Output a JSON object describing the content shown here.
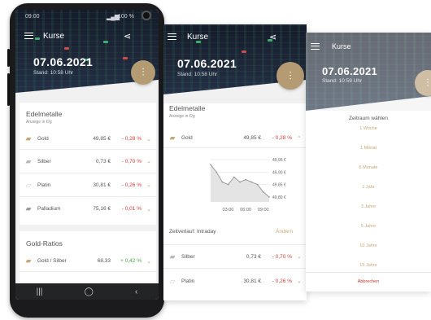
{
  "app": {
    "title": "Kurse"
  },
  "status": {
    "time": "09:00",
    "battery": "100 %"
  },
  "header": {
    "date": "07.06.2021",
    "stand_1": "Stand: 10:58 Uhr",
    "stand_2": "Stand: 10:58 Uhr",
    "stand_3": "Stand: 10:59 Uhr"
  },
  "colors": {
    "accent_gold": "#b59b73",
    "negative": "#d33a3a",
    "positive": "#4aa54a",
    "chevron": "#8ab34a"
  },
  "edelmetalle": {
    "title": "Edelmetalle",
    "subtitle": "Anzeige in €/g",
    "rows": [
      {
        "name": "Gold",
        "price": "49,85 €",
        "change": "- 0,28 %",
        "icon": "gold-bars-icon"
      },
      {
        "name": "Silber",
        "price": "0,73 €",
        "change": "- 0,70 %",
        "icon": "silver-bars-icon"
      },
      {
        "name": "Platin",
        "price": "30,81 €",
        "change": "- 0,26 %",
        "icon": "platinum-bars-icon"
      },
      {
        "name": "Palladium",
        "price": "75,16 €",
        "change": "- 0,01 %",
        "icon": "palladium-bars-icon"
      }
    ]
  },
  "gold_ratios": {
    "title": "Gold-Ratios",
    "rows": [
      {
        "name": "Gold / Silber",
        "value": "68,33",
        "change": "+ 0,42 %"
      }
    ]
  },
  "detail": {
    "gold_row": {
      "name": "Gold",
      "price": "49,85 €",
      "change": "- 0,28 %"
    },
    "y_ticks": [
      "49,95 €",
      "49,90 €",
      "49,85 €",
      "49,80 €"
    ],
    "x_ticks": [
      "03:00",
      "06:00",
      "09:00"
    ],
    "zeitverlauf": "Zeitverlauf: Intraday",
    "aendern": "Ändern",
    "rows": [
      {
        "name": "Silber",
        "price": "0,73 €",
        "change": "- 0,70 %"
      },
      {
        "name": "Platin",
        "price": "30,81 €",
        "change": "- 0,26 %"
      }
    ]
  },
  "chart_data": {
    "type": "area",
    "x": [
      "00:00",
      "01:00",
      "02:00",
      "03:00",
      "04:00",
      "05:00",
      "06:00",
      "07:00",
      "08:00",
      "09:00",
      "10:00"
    ],
    "values": [
      49.93,
      49.9,
      49.86,
      49.85,
      49.88,
      49.86,
      49.87,
      49.86,
      49.85,
      49.82,
      49.8
    ],
    "ylim": [
      49.78,
      49.97
    ],
    "title": "",
    "xlabel": "",
    "ylabel": ""
  },
  "zeitraum": {
    "title": "Zeitraum wählen",
    "options": [
      "1 Woche",
      "1 Monat",
      "6 Monate",
      "1 Jahr",
      "3 Jahre",
      "5 Jahre",
      "10 Jahre",
      "15 Jahre"
    ],
    "cancel": "Abbrechen"
  },
  "nav": {
    "recent": "|||",
    "home": "◯",
    "back": "‹"
  }
}
